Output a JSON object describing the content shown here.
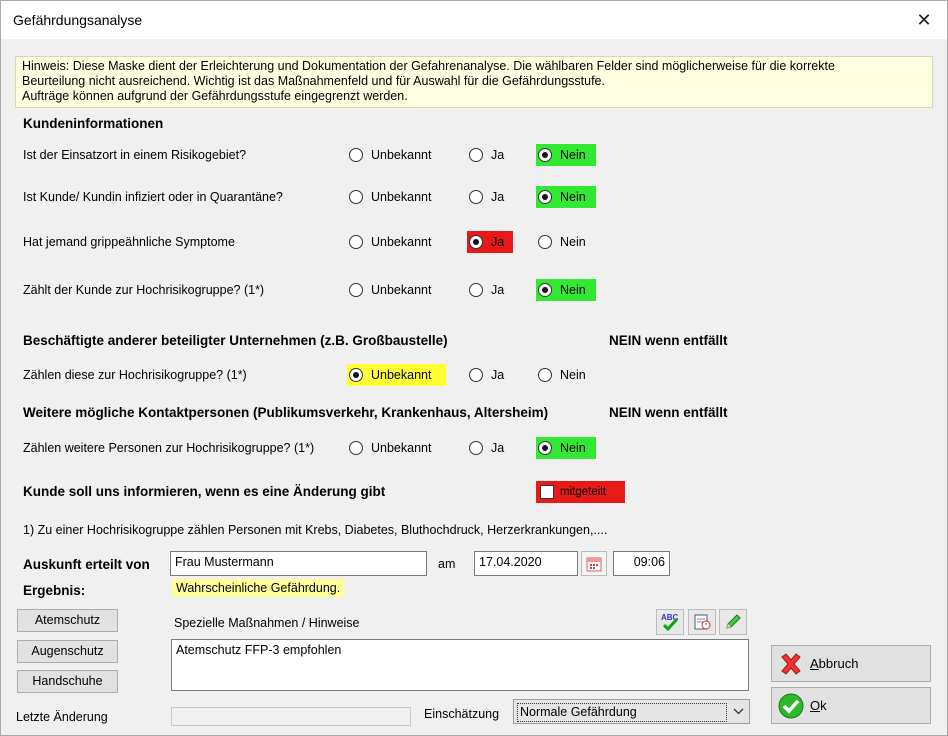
{
  "window": {
    "title": "Gefährdungsanalyse",
    "close_glyph": "✕"
  },
  "hint": "Hinweis: Diese Maske dient der Erleichterung und Dokumentation der Gefahrenanalyse. Die wählbaren Felder sind möglicherweise für die korrekte\nBeurteilung nicht ausreichend. Wichtig ist das Maßnahmenfeld und für Auswahl für die Gefährdungsstufe.\nAufträge können aufgrund der Gefährdungsstufe eingegrenzt werden.",
  "options": {
    "unknown": "Unbekannt",
    "yes": "Ja",
    "no": "Nein"
  },
  "customer": {
    "heading": "Kundeninformationen",
    "questions": [
      {
        "text": "Ist der Einsatzort in einem Risikogebiet?",
        "selected": "no",
        "highlight": "#33e833"
      },
      {
        "text": "Ist Kunde/ Kundin infiziert oder in Quarantäne?",
        "selected": "no",
        "highlight": "#33e833"
      },
      {
        "text": "Hat jemand grippeähnliche Symptome",
        "selected": "yes",
        "highlight": "#e81919"
      },
      {
        "text": "Zählt der Kunde zur Hochrisikogruppe? (1*)",
        "selected": "no",
        "highlight": "#33e833"
      }
    ]
  },
  "employees": {
    "heading": "Beschäftigte anderer beteiligter Unternehmen (z.B. Großbaustelle)",
    "note": "NEIN wenn entfällt",
    "question": {
      "text": "Zählen diese zur Hochrisikogruppe? (1*)",
      "selected": "unknown",
      "highlight": "#ffff33"
    }
  },
  "contacts": {
    "heading": "Weitere mögliche Kontaktpersonen (Publikumsverkehr, Krankenhaus, Altersheim)",
    "note": "NEIN wenn entfällt",
    "question": {
      "text": "Zählen weitere Personen zur Hochrisikogruppe? (1*)",
      "selected": "no",
      "highlight": "#33e833"
    }
  },
  "inform": {
    "text": "Kunde soll uns informieren, wenn es eine Änderung gibt",
    "checkbox_label": "mitgeteilt",
    "checked": false,
    "highlight": "#e81919"
  },
  "footnote": "1)  Zu einer Hochrisikogruppe zählen Personen mit Krebs, Diabetes, Bluthochdruck, Herzerkrankungen,....",
  "info": {
    "label": "Auskunft erteilt von",
    "value": "Frau Mustermann",
    "am_label": "am",
    "date": "17.04.2020",
    "time": "09:06"
  },
  "result": {
    "label": "Ergebnis:",
    "value": "Wahrscheinliche Gefährdung."
  },
  "buttons": {
    "atemschutz": "Atemschutz",
    "augenschutz": "Augenschutz",
    "handschuhe": "Handschuhe",
    "abbruch_key": "A",
    "abbruch_rest": "bbruch",
    "ok_key": "O",
    "ok_rest": "k"
  },
  "measures": {
    "label": "Spezielle Maßnahmen / Hinweise",
    "value": "Atemschutz FFP-3 empfohlen",
    "spell_icon_text": "ABC"
  },
  "footer": {
    "last_change_label": "Letzte Änderung",
    "last_change_value": "",
    "assessment_label": "Einschätzung",
    "assessment_value": "Normale Gefährdung"
  },
  "colors": {
    "green": "#33e833",
    "red": "#e81919",
    "yellow": "#ffff33",
    "hint_bg": "#ffffe1"
  }
}
